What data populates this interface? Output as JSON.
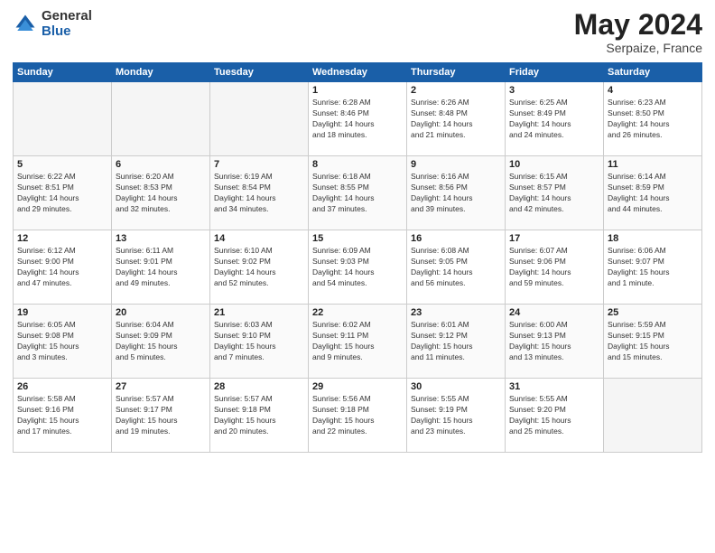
{
  "header": {
    "logo_general": "General",
    "logo_blue": "Blue",
    "month": "May 2024",
    "location": "Serpaize, France"
  },
  "days_of_week": [
    "Sunday",
    "Monday",
    "Tuesday",
    "Wednesday",
    "Thursday",
    "Friday",
    "Saturday"
  ],
  "weeks": [
    [
      {
        "day": "",
        "content": ""
      },
      {
        "day": "",
        "content": ""
      },
      {
        "day": "",
        "content": ""
      },
      {
        "day": "1",
        "content": "Sunrise: 6:28 AM\nSunset: 8:46 PM\nDaylight: 14 hours\nand 18 minutes."
      },
      {
        "day": "2",
        "content": "Sunrise: 6:26 AM\nSunset: 8:48 PM\nDaylight: 14 hours\nand 21 minutes."
      },
      {
        "day": "3",
        "content": "Sunrise: 6:25 AM\nSunset: 8:49 PM\nDaylight: 14 hours\nand 24 minutes."
      },
      {
        "day": "4",
        "content": "Sunrise: 6:23 AM\nSunset: 8:50 PM\nDaylight: 14 hours\nand 26 minutes."
      }
    ],
    [
      {
        "day": "5",
        "content": "Sunrise: 6:22 AM\nSunset: 8:51 PM\nDaylight: 14 hours\nand 29 minutes."
      },
      {
        "day": "6",
        "content": "Sunrise: 6:20 AM\nSunset: 8:53 PM\nDaylight: 14 hours\nand 32 minutes."
      },
      {
        "day": "7",
        "content": "Sunrise: 6:19 AM\nSunset: 8:54 PM\nDaylight: 14 hours\nand 34 minutes."
      },
      {
        "day": "8",
        "content": "Sunrise: 6:18 AM\nSunset: 8:55 PM\nDaylight: 14 hours\nand 37 minutes."
      },
      {
        "day": "9",
        "content": "Sunrise: 6:16 AM\nSunset: 8:56 PM\nDaylight: 14 hours\nand 39 minutes."
      },
      {
        "day": "10",
        "content": "Sunrise: 6:15 AM\nSunset: 8:57 PM\nDaylight: 14 hours\nand 42 minutes."
      },
      {
        "day": "11",
        "content": "Sunrise: 6:14 AM\nSunset: 8:59 PM\nDaylight: 14 hours\nand 44 minutes."
      }
    ],
    [
      {
        "day": "12",
        "content": "Sunrise: 6:12 AM\nSunset: 9:00 PM\nDaylight: 14 hours\nand 47 minutes."
      },
      {
        "day": "13",
        "content": "Sunrise: 6:11 AM\nSunset: 9:01 PM\nDaylight: 14 hours\nand 49 minutes."
      },
      {
        "day": "14",
        "content": "Sunrise: 6:10 AM\nSunset: 9:02 PM\nDaylight: 14 hours\nand 52 minutes."
      },
      {
        "day": "15",
        "content": "Sunrise: 6:09 AM\nSunset: 9:03 PM\nDaylight: 14 hours\nand 54 minutes."
      },
      {
        "day": "16",
        "content": "Sunrise: 6:08 AM\nSunset: 9:05 PM\nDaylight: 14 hours\nand 56 minutes."
      },
      {
        "day": "17",
        "content": "Sunrise: 6:07 AM\nSunset: 9:06 PM\nDaylight: 14 hours\nand 59 minutes."
      },
      {
        "day": "18",
        "content": "Sunrise: 6:06 AM\nSunset: 9:07 PM\nDaylight: 15 hours\nand 1 minute."
      }
    ],
    [
      {
        "day": "19",
        "content": "Sunrise: 6:05 AM\nSunset: 9:08 PM\nDaylight: 15 hours\nand 3 minutes."
      },
      {
        "day": "20",
        "content": "Sunrise: 6:04 AM\nSunset: 9:09 PM\nDaylight: 15 hours\nand 5 minutes."
      },
      {
        "day": "21",
        "content": "Sunrise: 6:03 AM\nSunset: 9:10 PM\nDaylight: 15 hours\nand 7 minutes."
      },
      {
        "day": "22",
        "content": "Sunrise: 6:02 AM\nSunset: 9:11 PM\nDaylight: 15 hours\nand 9 minutes."
      },
      {
        "day": "23",
        "content": "Sunrise: 6:01 AM\nSunset: 9:12 PM\nDaylight: 15 hours\nand 11 minutes."
      },
      {
        "day": "24",
        "content": "Sunrise: 6:00 AM\nSunset: 9:13 PM\nDaylight: 15 hours\nand 13 minutes."
      },
      {
        "day": "25",
        "content": "Sunrise: 5:59 AM\nSunset: 9:15 PM\nDaylight: 15 hours\nand 15 minutes."
      }
    ],
    [
      {
        "day": "26",
        "content": "Sunrise: 5:58 AM\nSunset: 9:16 PM\nDaylight: 15 hours\nand 17 minutes."
      },
      {
        "day": "27",
        "content": "Sunrise: 5:57 AM\nSunset: 9:17 PM\nDaylight: 15 hours\nand 19 minutes."
      },
      {
        "day": "28",
        "content": "Sunrise: 5:57 AM\nSunset: 9:18 PM\nDaylight: 15 hours\nand 20 minutes."
      },
      {
        "day": "29",
        "content": "Sunrise: 5:56 AM\nSunset: 9:18 PM\nDaylight: 15 hours\nand 22 minutes."
      },
      {
        "day": "30",
        "content": "Sunrise: 5:55 AM\nSunset: 9:19 PM\nDaylight: 15 hours\nand 23 minutes."
      },
      {
        "day": "31",
        "content": "Sunrise: 5:55 AM\nSunset: 9:20 PM\nDaylight: 15 hours\nand 25 minutes."
      },
      {
        "day": "",
        "content": ""
      }
    ]
  ]
}
